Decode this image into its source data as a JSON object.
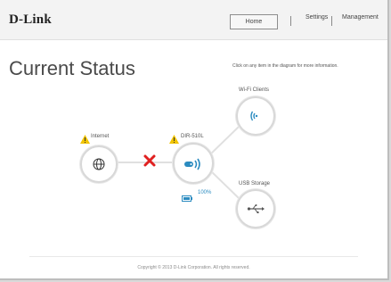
{
  "brand": {
    "logo": "D-Link"
  },
  "nav": {
    "home": "Home",
    "settings": "Settings",
    "management": "Management"
  },
  "page": {
    "title": "Current Status",
    "hint": "Click on any item in the diagram for more information."
  },
  "diagram": {
    "internet_label": "Internet",
    "router_label": "DIR-510L",
    "wifi_label": "Wi-Fi Clients",
    "usb_label": "USB Storage",
    "battery_percent": "100%"
  },
  "footer": {
    "copyright": "Copyright © 2013 D-Link Corporation. All rights reserved."
  },
  "colors": {
    "accent": "#2b8bc0",
    "warning": "#f2c400",
    "error": "#e02020",
    "ring": "#d8d8d8"
  }
}
